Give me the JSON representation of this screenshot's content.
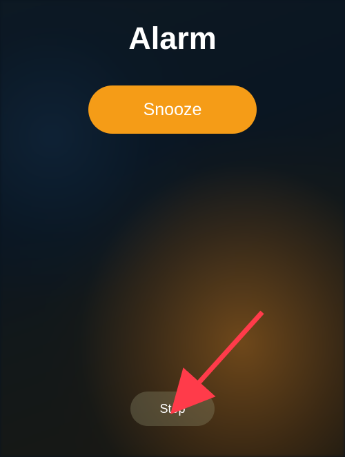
{
  "alarm": {
    "title": "Alarm",
    "snooze_label": "Snooze",
    "stop_label": "Stop"
  },
  "annotation": {
    "arrow_color": "#ff3b4a"
  }
}
